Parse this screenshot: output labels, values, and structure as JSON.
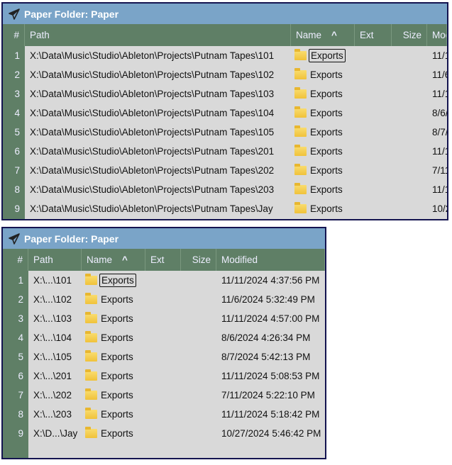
{
  "panel_title": "Paper Folder: Paper",
  "columns": {
    "num": "#",
    "path": "Path",
    "name": "Name",
    "sort_indicator": "^",
    "ext": "Ext",
    "size": "Size",
    "modified": "Modified"
  },
  "rows": [
    {
      "num": "1",
      "path": "X:\\Data\\Music\\Studio\\Ableton\\Projects\\Putnam Tapes\\101",
      "short_path": "X:\\...\\101",
      "name": "Exports",
      "ext": "",
      "size": "",
      "modified": "11/11/2024 4:37:56 PM"
    },
    {
      "num": "2",
      "path": "X:\\Data\\Music\\Studio\\Ableton\\Projects\\Putnam Tapes\\102",
      "short_path": "X:\\...\\102",
      "name": "Exports",
      "ext": "",
      "size": "",
      "modified": "11/6/2024 5:32:49 PM"
    },
    {
      "num": "3",
      "path": "X:\\Data\\Music\\Studio\\Ableton\\Projects\\Putnam Tapes\\103",
      "short_path": "X:\\...\\103",
      "name": "Exports",
      "ext": "",
      "size": "",
      "modified": "11/11/2024 4:57:00 PM"
    },
    {
      "num": "4",
      "path": "X:\\Data\\Music\\Studio\\Ableton\\Projects\\Putnam Tapes\\104",
      "short_path": "X:\\...\\104",
      "name": "Exports",
      "ext": "",
      "size": "",
      "modified": "8/6/2024 4:26:34 PM"
    },
    {
      "num": "5",
      "path": "X:\\Data\\Music\\Studio\\Ableton\\Projects\\Putnam Tapes\\105",
      "short_path": "X:\\...\\105",
      "name": "Exports",
      "ext": "",
      "size": "",
      "modified": "8/7/2024 5:42:13 PM"
    },
    {
      "num": "6",
      "path": "X:\\Data\\Music\\Studio\\Ableton\\Projects\\Putnam Tapes\\201",
      "short_path": "X:\\...\\201",
      "name": "Exports",
      "ext": "",
      "size": "",
      "modified": "11/11/2024 5:08:53 PM"
    },
    {
      "num": "7",
      "path": "X:\\Data\\Music\\Studio\\Ableton\\Projects\\Putnam Tapes\\202",
      "short_path": "X:\\...\\202",
      "name": "Exports",
      "ext": "",
      "size": "",
      "modified": "7/11/2024 5:22:10 PM"
    },
    {
      "num": "8",
      "path": "X:\\Data\\Music\\Studio\\Ableton\\Projects\\Putnam Tapes\\203",
      "short_path": "X:\\...\\203",
      "name": "Exports",
      "ext": "",
      "size": "",
      "modified": "11/11/2024 5:18:42 PM"
    },
    {
      "num": "9",
      "path": "X:\\Data\\Music\\Studio\\Ableton\\Projects\\Putnam Tapes\\Jay",
      "short_path": "X:\\D...\\Jay",
      "name": "Exports",
      "ext": "",
      "size": "",
      "modified": "10/27/2024 5:46:42 PM"
    }
  ],
  "selected_row": 0,
  "colors": {
    "title_bar": "#7aa4c8",
    "header": "#5f7f66",
    "body": "#d9d9d9",
    "border": "#141450"
  }
}
